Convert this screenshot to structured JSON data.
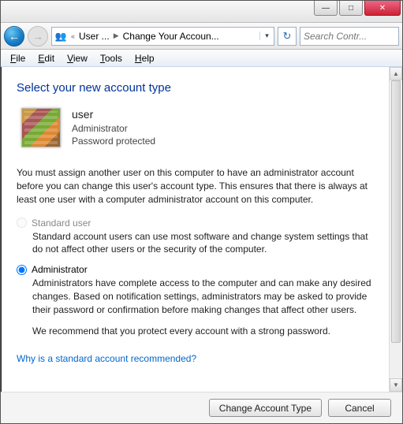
{
  "titlebar": {
    "min": "—",
    "max": "□",
    "close": "✕"
  },
  "nav": {
    "crumb_parent": "User ...",
    "crumb_title": "Change Your Accoun...",
    "search_placeholder": "Search Contr..."
  },
  "menu": {
    "file": "File",
    "edit": "Edit",
    "view": "View",
    "tools": "Tools",
    "help": "Help"
  },
  "main": {
    "heading": "Select your new account type",
    "user": {
      "name": "user",
      "role": "Administrator",
      "protection": "Password protected"
    },
    "notice": "You must assign another user on this computer to have an administrator account before you can change this user's account type. This ensures that there is always at least one user with a computer administrator account on this computer.",
    "options": {
      "standard": {
        "label": "Standard user",
        "desc": "Standard account users can use most software and change system settings that do not affect other users or the security of the computer.",
        "enabled": false,
        "selected": false
      },
      "admin": {
        "label": "Administrator",
        "desc": "Administrators have complete access to the computer and can make any desired changes. Based on notification settings, administrators may be asked to provide their password or confirmation before making changes that affect other users.",
        "enabled": true,
        "selected": true
      }
    },
    "recommend": "We recommend that you protect every account with a strong password.",
    "link": "Why is a standard account recommended?"
  },
  "footer": {
    "change": "Change Account Type",
    "cancel": "Cancel"
  }
}
